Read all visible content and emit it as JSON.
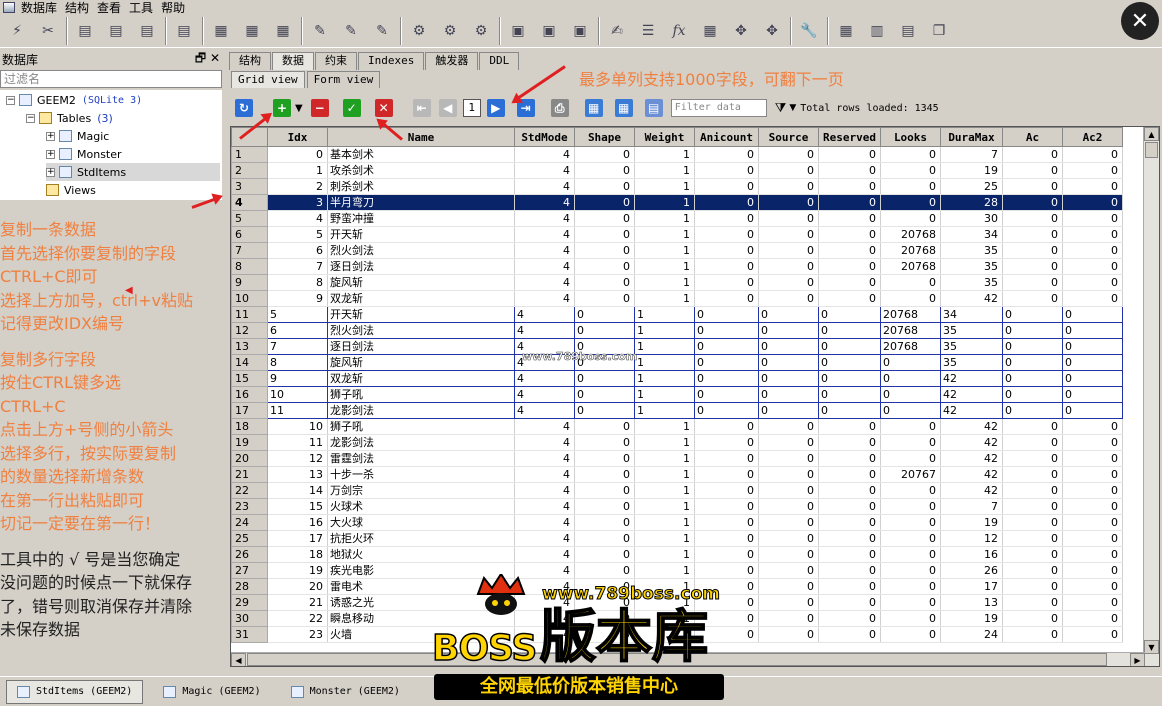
{
  "menu": [
    "数据库",
    "结构",
    "查看",
    "工具",
    "帮助"
  ],
  "left_panel": {
    "title": "数据库",
    "filter_placeholder": "过滤名",
    "tree": {
      "db": "GEEM2",
      "db_type": "(SQLite 3)",
      "tables_label": "Tables",
      "tables_count": "(3)",
      "tables": [
        "Magic",
        "Monster",
        "StdItems"
      ],
      "views_label": "Views"
    }
  },
  "tabs": [
    "结构",
    "数据",
    "约束",
    "Indexes",
    "触发器",
    "DDL"
  ],
  "subtabs": [
    "Grid view",
    "Form view"
  ],
  "grid_toolbar": {
    "page": "1",
    "filter_placeholder": "Filter data",
    "total": "Total rows loaded: 1345"
  },
  "columns": [
    "Idx",
    "Name",
    "StdMode",
    "Shape",
    "Weight",
    "Anicount",
    "Source",
    "Reserved",
    "Looks",
    "DuraMax",
    "Ac",
    "Ac2"
  ],
  "rows": [
    [
      "1",
      "0",
      "基本剑术",
      "4",
      "0",
      "1",
      "0",
      "0",
      "0",
      "0",
      "7",
      "0",
      "0"
    ],
    [
      "2",
      "1",
      "攻杀剑术",
      "4",
      "0",
      "1",
      "0",
      "0",
      "0",
      "0",
      "19",
      "0",
      "0"
    ],
    [
      "3",
      "2",
      "刺杀剑术",
      "4",
      "0",
      "1",
      "0",
      "0",
      "0",
      "0",
      "25",
      "0",
      "0"
    ],
    [
      "4",
      "3",
      "半月弯刀",
      "4",
      "0",
      "1",
      "0",
      "0",
      "0",
      "0",
      "28",
      "0",
      "0"
    ],
    [
      "5",
      "4",
      "野蛮冲撞",
      "4",
      "0",
      "1",
      "0",
      "0",
      "0",
      "0",
      "30",
      "0",
      "0"
    ],
    [
      "6",
      "5",
      "开天斩",
      "4",
      "0",
      "1",
      "0",
      "0",
      "0",
      "20768",
      "34",
      "0",
      "0"
    ],
    [
      "7",
      "6",
      "烈火剑法",
      "4",
      "0",
      "1",
      "0",
      "0",
      "0",
      "20768",
      "35",
      "0",
      "0"
    ],
    [
      "8",
      "7",
      "逐日剑法",
      "4",
      "0",
      "1",
      "0",
      "0",
      "0",
      "20768",
      "35",
      "0",
      "0"
    ],
    [
      "9",
      "8",
      "旋风斩",
      "4",
      "0",
      "1",
      "0",
      "0",
      "0",
      "0",
      "35",
      "0",
      "0"
    ],
    [
      "10",
      "9",
      "双龙斩",
      "4",
      "0",
      "1",
      "0",
      "0",
      "0",
      "0",
      "42",
      "0",
      "0"
    ],
    [
      "11",
      "5",
      "开天斩",
      "4",
      "0",
      "1",
      "0",
      "0",
      "0",
      "20768",
      "34",
      "0",
      "0"
    ],
    [
      "12",
      "6",
      "烈火剑法",
      "4",
      "0",
      "1",
      "0",
      "0",
      "0",
      "20768",
      "35",
      "0",
      "0"
    ],
    [
      "13",
      "7",
      "逐日剑法",
      "4",
      "0",
      "1",
      "0",
      "0",
      "0",
      "20768",
      "35",
      "0",
      "0"
    ],
    [
      "14",
      "8",
      "旋风斩",
      "4",
      "0",
      "1",
      "0",
      "0",
      "0",
      "0",
      "35",
      "0",
      "0"
    ],
    [
      "15",
      "9",
      "双龙斩",
      "4",
      "0",
      "1",
      "0",
      "0",
      "0",
      "0",
      "42",
      "0",
      "0"
    ],
    [
      "16",
      "10",
      "狮子吼",
      "4",
      "0",
      "1",
      "0",
      "0",
      "0",
      "0",
      "42",
      "0",
      "0"
    ],
    [
      "17",
      "11",
      "龙影剑法",
      "4",
      "0",
      "1",
      "0",
      "0",
      "0",
      "0",
      "42",
      "0",
      "0"
    ],
    [
      "18",
      "10",
      "狮子吼",
      "4",
      "0",
      "1",
      "0",
      "0",
      "0",
      "0",
      "42",
      "0",
      "0"
    ],
    [
      "19",
      "11",
      "龙影剑法",
      "4",
      "0",
      "1",
      "0",
      "0",
      "0",
      "0",
      "42",
      "0",
      "0"
    ],
    [
      "20",
      "12",
      "雷霆剑法",
      "4",
      "0",
      "1",
      "0",
      "0",
      "0",
      "0",
      "42",
      "0",
      "0"
    ],
    [
      "21",
      "13",
      "十步一杀",
      "4",
      "0",
      "1",
      "0",
      "0",
      "0",
      "20767",
      "42",
      "0",
      "0"
    ],
    [
      "22",
      "14",
      "万剑宗",
      "4",
      "0",
      "1",
      "0",
      "0",
      "0",
      "0",
      "42",
      "0",
      "0"
    ],
    [
      "23",
      "15",
      "火球术",
      "4",
      "0",
      "1",
      "0",
      "0",
      "0",
      "0",
      "7",
      "0",
      "0"
    ],
    [
      "24",
      "16",
      "大火球",
      "4",
      "0",
      "1",
      "0",
      "0",
      "0",
      "0",
      "19",
      "0",
      "0"
    ],
    [
      "25",
      "17",
      "抗拒火环",
      "4",
      "0",
      "1",
      "0",
      "0",
      "0",
      "0",
      "12",
      "0",
      "0"
    ],
    [
      "26",
      "18",
      "地狱火",
      "4",
      "0",
      "1",
      "0",
      "0",
      "0",
      "0",
      "16",
      "0",
      "0"
    ],
    [
      "27",
      "19",
      "疾光电影",
      "4",
      "0",
      "1",
      "0",
      "0",
      "0",
      "0",
      "26",
      "0",
      "0"
    ],
    [
      "28",
      "20",
      "雷电术",
      "4",
      "0",
      "1",
      "0",
      "0",
      "0",
      "0",
      "17",
      "0",
      "0"
    ],
    [
      "29",
      "21",
      "诱惑之光",
      "4",
      "0",
      "1",
      "0",
      "0",
      "0",
      "0",
      "13",
      "0",
      "0"
    ],
    [
      "30",
      "22",
      "瞬息移动",
      "4",
      "0",
      "1",
      "0",
      "0",
      "0",
      "0",
      "19",
      "0",
      "0"
    ],
    [
      "31",
      "23",
      "火墙",
      "4",
      "0",
      "1",
      "0",
      "0",
      "0",
      "0",
      "24",
      "0",
      "0"
    ]
  ],
  "selected_row": 3,
  "inserted_rows": [
    10,
    11,
    12,
    13,
    14,
    15,
    16
  ],
  "annotations": {
    "copy_one": [
      "复制一条数据",
      "首先选择你要复制的字段",
      "CTRL+C即可",
      "选择上方加号，ctrl+v粘贴",
      "记得更改IDX编号"
    ],
    "copy_multi": [
      "复制多行字段",
      "按住CTRL键多选",
      "CTRL+C",
      "点击上方+号侧的小箭头",
      "选择多行，按实际要复制",
      "的数量选择新增条数",
      "在第一行出粘贴即可",
      "切记一定要在第一行！"
    ],
    "confirm": [
      "工具中的 √ 号是当您确定",
      "没问题的时候点一下就保存",
      "了，错号则取消保存并清除",
      "未保存数据"
    ],
    "top_note": "最多单列支持1000字段，可翻下一页"
  },
  "taskbar": [
    "StdItems (GEEM2)",
    "Magic (GEEM2)",
    "Monster (GEEM2)"
  ],
  "watermark": {
    "site": "www.789boss.com",
    "brand_en": "BOSS",
    "brand_cn": "版本库",
    "slogan": "全网最低价版本销售中心",
    "faint": "www.789boss.com"
  },
  "colors": {
    "annotation": "#f08040",
    "selected": "#0a246a",
    "arrow": "#e02020"
  }
}
